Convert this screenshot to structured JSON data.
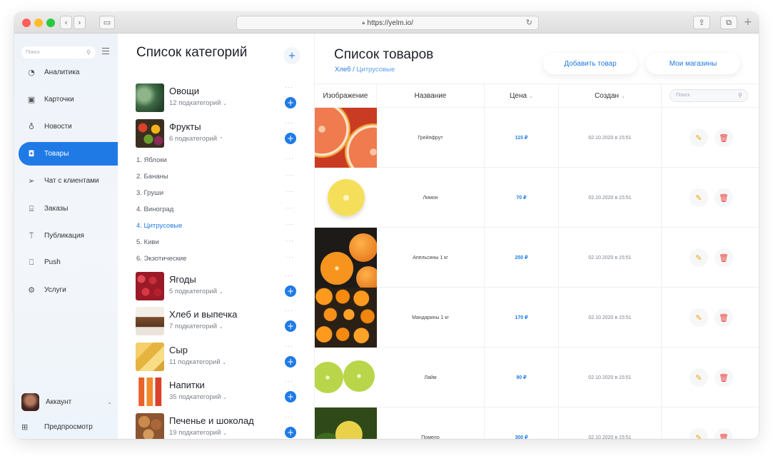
{
  "browser": {
    "url": "https://yelm.io/"
  },
  "sidebar": {
    "search_placeholder": "Поиск",
    "items": [
      {
        "label": "Аналитика",
        "icon": "analytics-icon",
        "active": false
      },
      {
        "label": "Карточки",
        "icon": "cards-icon",
        "active": false
      },
      {
        "label": "Новости",
        "icon": "news-icon",
        "active": false
      },
      {
        "label": "Товары",
        "icon": "products-icon",
        "active": true
      },
      {
        "label": "Чат с клиентами",
        "icon": "chat-icon",
        "active": false
      },
      {
        "label": "Заказы",
        "icon": "orders-icon",
        "active": false
      },
      {
        "label": "Публикация",
        "icon": "publish-icon",
        "active": false
      },
      {
        "label": "Push",
        "icon": "push-icon",
        "active": false
      },
      {
        "label": "Услуги",
        "icon": "services-icon",
        "active": false
      }
    ],
    "account_label": "Аккаунт",
    "preview_label": "Предпросмотр"
  },
  "categories": {
    "title": "Список категорий",
    "add_symbol": "+",
    "more_symbol": "···",
    "items": [
      {
        "name": "Овощи",
        "sub": "12 подкатегорий",
        "expanded": false
      },
      {
        "name": "Фрукты",
        "sub": "6 подкатегорий",
        "expanded": true
      },
      {
        "name": "Ягоды",
        "sub": "5 подкатегорий",
        "expanded": false
      },
      {
        "name": "Хлеб и выпечка",
        "sub": "7 подкатегорий",
        "expanded": false
      },
      {
        "name": "Сыр",
        "sub": "11 подкатегорий",
        "expanded": false
      },
      {
        "name": "Напитки",
        "sub": "35 подкатегорий",
        "expanded": false
      },
      {
        "name": "Печенье и шоколад",
        "sub": "19 подкатегорий",
        "expanded": false
      }
    ],
    "subcategories": [
      {
        "label": "1. Яблоки",
        "active": false
      },
      {
        "label": "2. Бананы",
        "active": false
      },
      {
        "label": "3. Груши",
        "active": false
      },
      {
        "label": "4. Виноград",
        "active": false
      },
      {
        "label": "4. Цитрусовые",
        "active": true
      },
      {
        "label": "5. Киви",
        "active": false
      },
      {
        "label": "6. Экзотические",
        "active": false
      }
    ]
  },
  "products": {
    "title": "Список товаров",
    "breadcrumb": {
      "parent": "Хлеб",
      "sep": "/",
      "current": "Цитрусовые"
    },
    "add_button": "Добавить товар",
    "shops_button": "Мои магазины",
    "columns": [
      "Изображение",
      "Название",
      "Цена",
      "Создан"
    ],
    "search_placeholder": "Поиск",
    "rows": [
      {
        "name": "Грейпфрут",
        "price": "115 ₽",
        "created": "02.10.2020 в 15:51"
      },
      {
        "name": "Лимон",
        "price": "70 ₽",
        "created": "02.10.2020 в 15:51"
      },
      {
        "name": "Апельсины 1 кг",
        "price": "250 ₽",
        "created": "02.10.2020 в 15:51"
      },
      {
        "name": "Мандарины 1 кг",
        "price": "170 ₽",
        "created": "02.10.2020 в 15:51"
      },
      {
        "name": "Лайм",
        "price": "90 ₽",
        "created": "02.10.2020 в 15:51"
      },
      {
        "name": "Помело",
        "price": "300 ₽",
        "created": "02.10.2020 в 15:51"
      }
    ]
  },
  "colors": {
    "accent": "#1f7ae6",
    "edit": "#f0a500",
    "delete": "#e8413a"
  }
}
